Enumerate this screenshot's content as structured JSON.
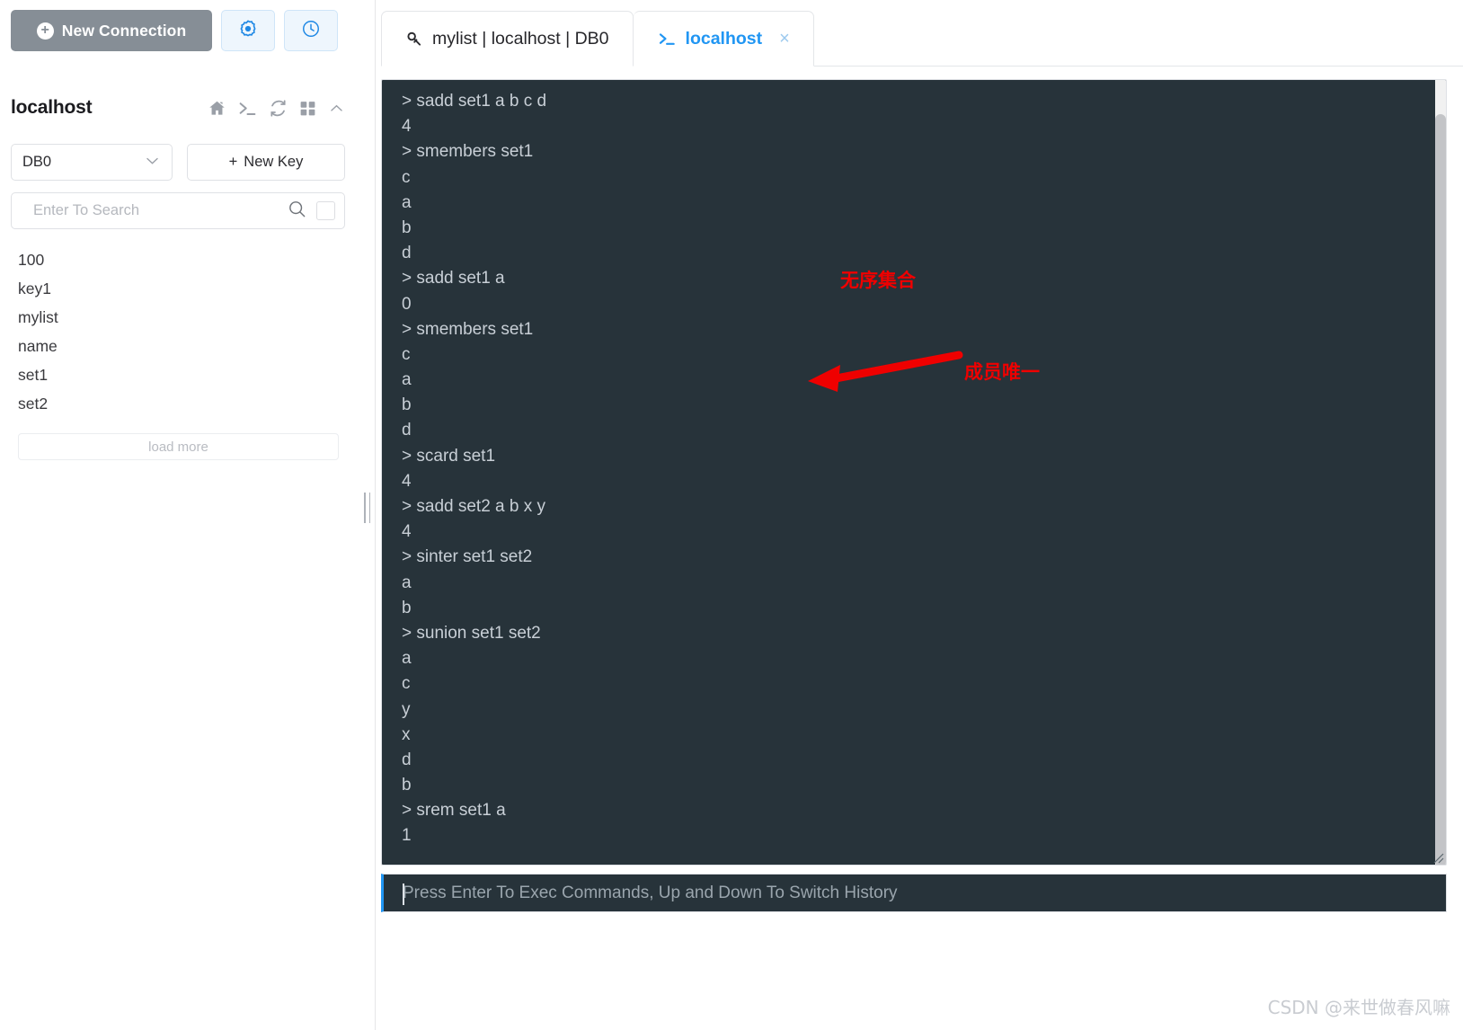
{
  "sidebar": {
    "new_connection_label": "New Connection",
    "settings_icon": "gear-icon",
    "history_icon": "clock-icon",
    "connection_title": "localhost",
    "header_icons": [
      "home-icon",
      "terminal-icon",
      "refresh-icon",
      "grid-icon",
      "chevron-up-icon"
    ],
    "db_selected": "DB0",
    "new_key_label": "New Key",
    "search_placeholder": "Enter To Search",
    "search_value": "",
    "keys": [
      "100",
      "key1",
      "mylist",
      "name",
      "set1",
      "set2"
    ],
    "load_more_label": "load more"
  },
  "tabs": [
    {
      "label": "mylist | localhost | DB0",
      "icon": "key-icon",
      "active": false,
      "closable": false
    },
    {
      "label": "localhost",
      "icon": "terminal-icon",
      "active": true,
      "closable": true,
      "close_label": "×"
    }
  ],
  "terminal": {
    "lines": [
      "> sadd set1 a b c d",
      "4",
      "> smembers set1",
      "c",
      "a",
      "b",
      "d",
      "> sadd set1 a",
      "0",
      "> smembers set1",
      "c",
      "a",
      "b",
      "d",
      "> scard set1",
      "4",
      "> sadd set2 a b x y",
      "4",
      "> sinter set1 set2",
      "a",
      "b",
      "> sunion set1 set2",
      "a",
      "c",
      "y",
      "x",
      "d",
      "b",
      "> srem set1 a",
      "1"
    ],
    "bg_color": "#27333a",
    "text_color": "#c8cfd6"
  },
  "annotations": {
    "note_1": "无序集合",
    "note_2": "成员唯一",
    "color": "#ef0000"
  },
  "command_input": {
    "placeholder": "Press Enter To Exec Commands, Up and Down To Switch History",
    "value": ""
  },
  "watermark": {
    "text": "CSDN @来世做春风嘛"
  },
  "colors": {
    "accent": "#2196f3",
    "terminal_bg": "#27333a",
    "button_gray": "#868e96"
  }
}
